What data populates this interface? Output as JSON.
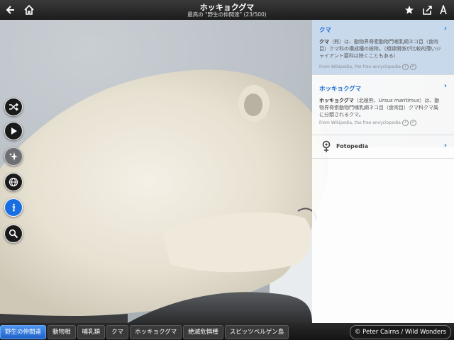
{
  "header": {
    "title": "ホッキョクグマ",
    "subtitle": "最高の \"野生の仲間達\" (23/500)",
    "back_icon": "arrow-left-icon",
    "home_icon": "home-icon",
    "star_icon": "star-icon",
    "share_icon": "share-icon",
    "text_icon": "text-size-icon"
  },
  "tools": [
    {
      "name": "shuffle-icon"
    },
    {
      "name": "play-icon"
    },
    {
      "name": "sparkle-icon"
    },
    {
      "name": "globe-icon"
    },
    {
      "name": "info-icon"
    },
    {
      "name": "search-icon"
    }
  ],
  "panel": {
    "cards": [
      {
        "title": "クマ",
        "body_bold": "クマ",
        "body": "（熊）は、動物界脊索動物門哺乳綱ネコ目（食肉目）クマ科の構成種の総称。（頬縁関係が比較的薄いジャイアント亜科は除くこともある）",
        "source": "From Wikipedia, the free encyclopedia"
      },
      {
        "title": "ホッキョクグマ",
        "body_bold": "ホッキョクグマ",
        "body_pre": "（北極熊、",
        "body_italic": "Ursus maritimus",
        "body_post": "）は、動物界脊索動物門哺乳綱ネコ目（食肉目）クマ科クマ属に分類されるクマ。",
        "source": "From Wikipedia, the free encyclopedia"
      }
    ],
    "fotopedia_label": "Fotopedia"
  },
  "breadcrumbs": [
    "野生の仲間達",
    "動物相",
    "哺乳類",
    "クマ",
    "ホッキョクグマ",
    "絶滅危惧種",
    "スピッツベルゲン島"
  ],
  "credit": "© Peter Cairns / Wild Wonders",
  "colors": {
    "accent": "#1f6fd6",
    "selected_card": "#c9d9ec",
    "crumb_active": "#2f7ae0"
  }
}
